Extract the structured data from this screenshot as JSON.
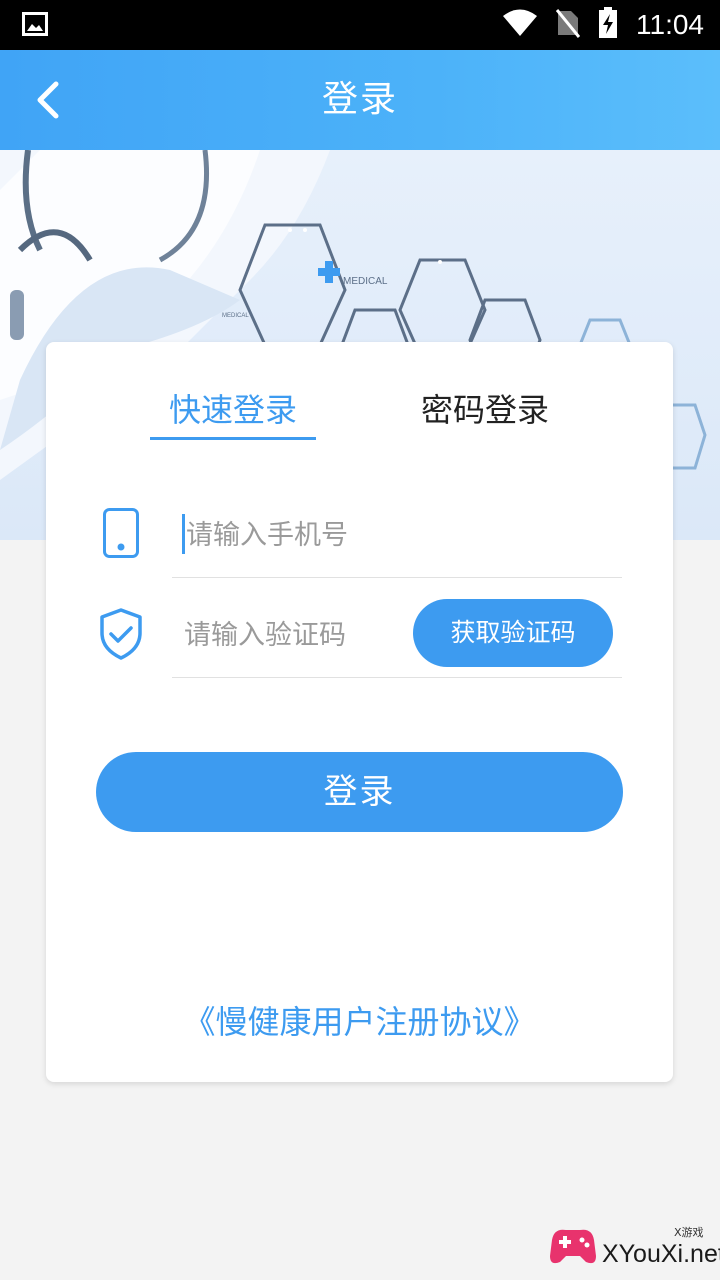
{
  "status_bar": {
    "time": "11:04",
    "icons": [
      "image-icon",
      "wifi-icon",
      "no-sim-icon",
      "battery-charging-icon"
    ]
  },
  "app_bar": {
    "title": "登录",
    "back_icon": "chevron-left-icon"
  },
  "banner": {
    "label_1": "MEDICAL",
    "label_2": "MEDICAL"
  },
  "login_card": {
    "tabs": [
      {
        "label": "快速登录",
        "active": true
      },
      {
        "label": "密码登录",
        "active": false
      }
    ],
    "phone_field": {
      "icon": "phone-icon",
      "value": "",
      "placeholder": "请输入手机号"
    },
    "code_field": {
      "icon": "shield-check-icon",
      "value": "",
      "placeholder": "请输入验证码"
    },
    "get_code_label": "获取验证码",
    "login_label": "登录",
    "agreement_link": "《慢健康用户注册协议》"
  },
  "watermark": {
    "text": "XYouXi.net",
    "small": "X游戏"
  },
  "colors": {
    "accent": "#3d9bf0",
    "app_bar": "#45a9f7",
    "background": "#f3f3f3"
  }
}
